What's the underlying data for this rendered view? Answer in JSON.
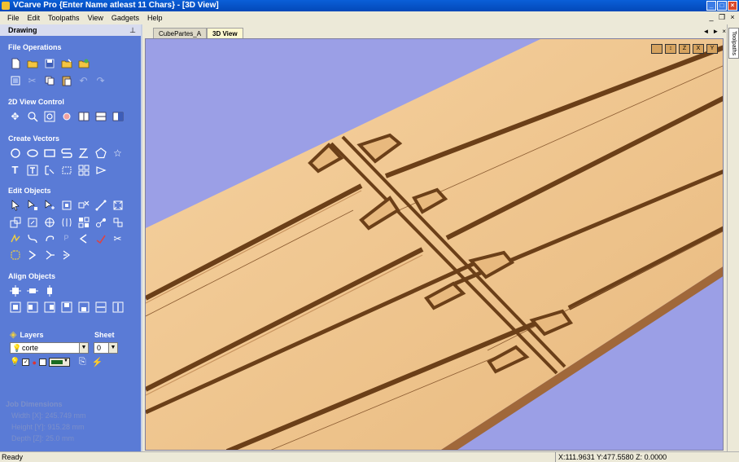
{
  "window": {
    "title": "VCarve Pro {Enter Name atleast 11 Chars} - [3D View]"
  },
  "menu": [
    "File",
    "Edit",
    "Toolpaths",
    "View",
    "Gadgets",
    "Help"
  ],
  "left_panel": {
    "header": "Drawing",
    "sections": {
      "file_operations": "File Operations",
      "view_control": "2D View Control",
      "create_vectors": "Create Vectors",
      "edit_objects": "Edit Objects",
      "align_objects": "Align Objects"
    },
    "layers": {
      "label": "Layers",
      "sheet_label": "Sheet",
      "current_layer": "corte",
      "current_sheet": "0"
    },
    "job_dimensions": {
      "title": "Job Dimensions",
      "width": "Width  [X]: 245.749 mm",
      "height": "Height [Y]: 915.28 mm",
      "depth": "Depth  [Z]: 25.0 mm"
    }
  },
  "tabs": [
    {
      "label": "CubePartes_A",
      "active": false
    },
    {
      "label": "3D View",
      "active": true
    }
  ],
  "view_icons": [
    "",
    "↕",
    "Z",
    "X",
    "Y"
  ],
  "right_sidebar": {
    "label": "Toolpaths"
  },
  "status": {
    "left": "Ready",
    "coords": "X:111.9631 Y:477.5580 Z:  0.0000"
  },
  "colors": {
    "title_bar": "#0a5fd8",
    "panel": "#5a7bd6",
    "viewport_bg": "#9b9fe6",
    "wood": "#edc490",
    "wood_shadow": "#7a4a20"
  }
}
